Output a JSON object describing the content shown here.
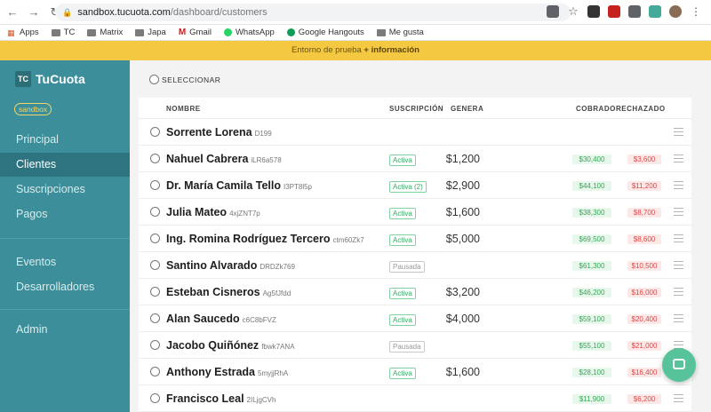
{
  "browser": {
    "url_host": "sandbox.tucuota.com",
    "url_path": "/dashboard/customers",
    "bookmarks": [
      "Apps",
      "TC",
      "Matrix",
      "Japa",
      "Gmail",
      "WhatsApp",
      "Google Hangouts",
      "Me gusta"
    ]
  },
  "banner": {
    "text": "Entorno de prueba",
    "link": "+ información"
  },
  "sidebar": {
    "logo_mark": "TC",
    "logo_text": "TuCuota",
    "env_tag": "sandbox",
    "items": [
      "Principal",
      "Clientes",
      "Suscripciones",
      "Pagos",
      "Eventos",
      "Desarrolladores",
      "Admin"
    ],
    "active_index": 1
  },
  "main": {
    "select_label": "SELECCIONAR",
    "columns": [
      "NOMBRE",
      "SUSCRIPCIÓN",
      "GENERA",
      "COBRADO",
      "RECHAZADO"
    ],
    "rows": [
      {
        "name": "Sorrente Lorena",
        "code": "D199",
        "status": "",
        "genera": "",
        "cobrado": "",
        "rechazado": ""
      },
      {
        "name": "Nahuel Cabrera",
        "code": "iLR6a578",
        "status": "Activa",
        "genera": "$1,200",
        "cobrado": "$30,400",
        "rechazado": "$3,600"
      },
      {
        "name": "Dr. María Camila Tello",
        "code": "I3PT8l5p",
        "status": "Activa (2)",
        "genera": "$2,900",
        "cobrado": "$44,100",
        "rechazado": "$11,200"
      },
      {
        "name": "Julia Mateo",
        "code": "4xjZNT7p",
        "status": "Activa",
        "genera": "$1,600",
        "cobrado": "$38,300",
        "rechazado": "$8,700"
      },
      {
        "name": "Ing. Romina Rodríguez Tercero",
        "code": "ctm60Zk7",
        "status": "Activa",
        "genera": "$5,000",
        "cobrado": "$69,500",
        "rechazado": "$8,600"
      },
      {
        "name": "Santino Alvarado",
        "code": "DRDZk769",
        "status": "Pausada",
        "genera": "",
        "cobrado": "$61,300",
        "rechazado": "$10,500"
      },
      {
        "name": "Esteban Cisneros",
        "code": "Ag5fJfdd",
        "status": "Activa",
        "genera": "$3,200",
        "cobrado": "$46,200",
        "rechazado": "$16,000"
      },
      {
        "name": "Alan Saucedo",
        "code": "c6C8bFVZ",
        "status": "Activa",
        "genera": "$4,000",
        "cobrado": "$59,100",
        "rechazado": "$20,400"
      },
      {
        "name": "Jacobo Quiñónez",
        "code": "fbwk7ANA",
        "status": "Pausada",
        "genera": "",
        "cobrado": "$55,100",
        "rechazado": "$21,000"
      },
      {
        "name": "Anthony Estrada",
        "code": "5myjjRhA",
        "status": "Activa",
        "genera": "$1,600",
        "cobrado": "$28,100",
        "rechazado": "$16,400"
      },
      {
        "name": "Francisco Leal",
        "code": "2ILjgCVh",
        "status": "",
        "genera": "",
        "cobrado": "$11,900",
        "rechazado": "$6,200"
      }
    ]
  }
}
